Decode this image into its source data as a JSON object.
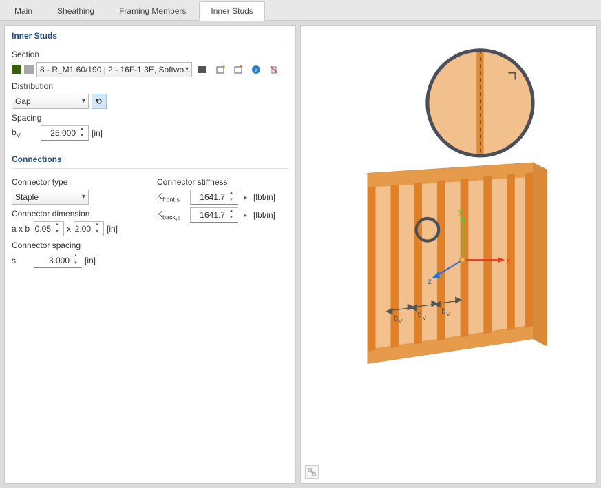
{
  "tabs": {
    "main": "Main",
    "sheathing": "Sheathing",
    "framing": "Framing Members",
    "inner_studs": "Inner Studs"
  },
  "inner_studs": {
    "title": "Inner Studs",
    "section_label": "Section",
    "section_value": "8 - R_M1 60/190 | 2 - 16F-1.3E, Softwo...",
    "distribution_label": "Distribution",
    "distribution_value": "Gap",
    "spacing_label": "Spacing",
    "bv_symbol": "b",
    "bv_sub": "V",
    "bv_value": "25.000",
    "bv_unit": "[in]"
  },
  "connections": {
    "title": "Connections",
    "connector_type_label": "Connector type",
    "connector_type_value": "Staple",
    "connector_dimension_label": "Connector dimension",
    "axb_label": "a x b",
    "a_value": "0.05",
    "x_label": "x",
    "b_value": "2.00",
    "axb_unit": "[in]",
    "connector_spacing_label": "Connector spacing",
    "s_label": "s",
    "s_value": "3.000",
    "s_unit": "[in]",
    "stiffness_label": "Connector stiffness",
    "k_front_symbol": "K",
    "k_front_sub": "front,s",
    "k_front_value": "1641.7",
    "k_front_unit": "[lbf/in]",
    "k_back_symbol": "K",
    "k_back_sub": "back,s",
    "k_back_value": "1641.7",
    "k_back_unit": "[lbf/in]"
  },
  "viewport": {
    "axis_x": "x",
    "axis_y": "y",
    "axis_z": "z",
    "bv_label": "b",
    "bv_sub": "V"
  }
}
